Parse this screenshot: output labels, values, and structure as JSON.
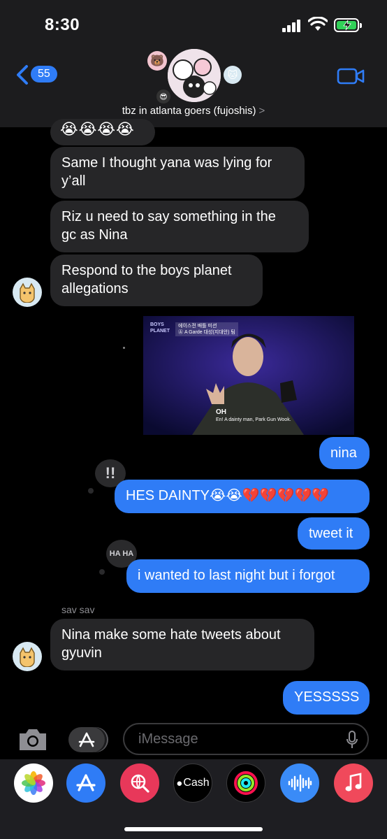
{
  "status": {
    "time": "8:30"
  },
  "header": {
    "back_count": "55",
    "group_name": "tbz in atlanta goers (fujoshis)",
    "chevron": ">"
  },
  "messages": {
    "top_emoji": "😭😭😭😭",
    "m1": [
      "Same I thought yana was lying for",
      "y’all"
    ],
    "m2": [
      "Riz u need to say something in the",
      "gc as Nina"
    ],
    "m3": [
      "Respond to the boys planet",
      "allegations"
    ],
    "photo_caption": "En! A dainty man, Park Gun Wook.",
    "photo_badge_top": "BOYS",
    "photo_badge_bot": "PLANET",
    "photo_overlay": "OH",
    "photo_header_line1": "에이스전 배틀 미션",
    "photo_header_line2": "Ⓐ A Garde 대성(지대안) 팀",
    "s1": "nina",
    "tapback_1": "!!",
    "s2": "HES DAINTY😭😭💔💔💔💔💔",
    "s3": "tweet it",
    "tapback_2": "HA HA",
    "s4": "i wanted to last night but i forgot",
    "sender_label": "sav sav",
    "m4": [
      "Nina make some hate tweets about",
      "gyuvin"
    ],
    "s5": "YESSSSS"
  },
  "input": {
    "placeholder": "iMessage"
  },
  "tray": {
    "cash_label": "Cash"
  },
  "colors": {
    "accent": "#2f7cf6",
    "received": "#262628",
    "header": "#1c1c1e"
  }
}
